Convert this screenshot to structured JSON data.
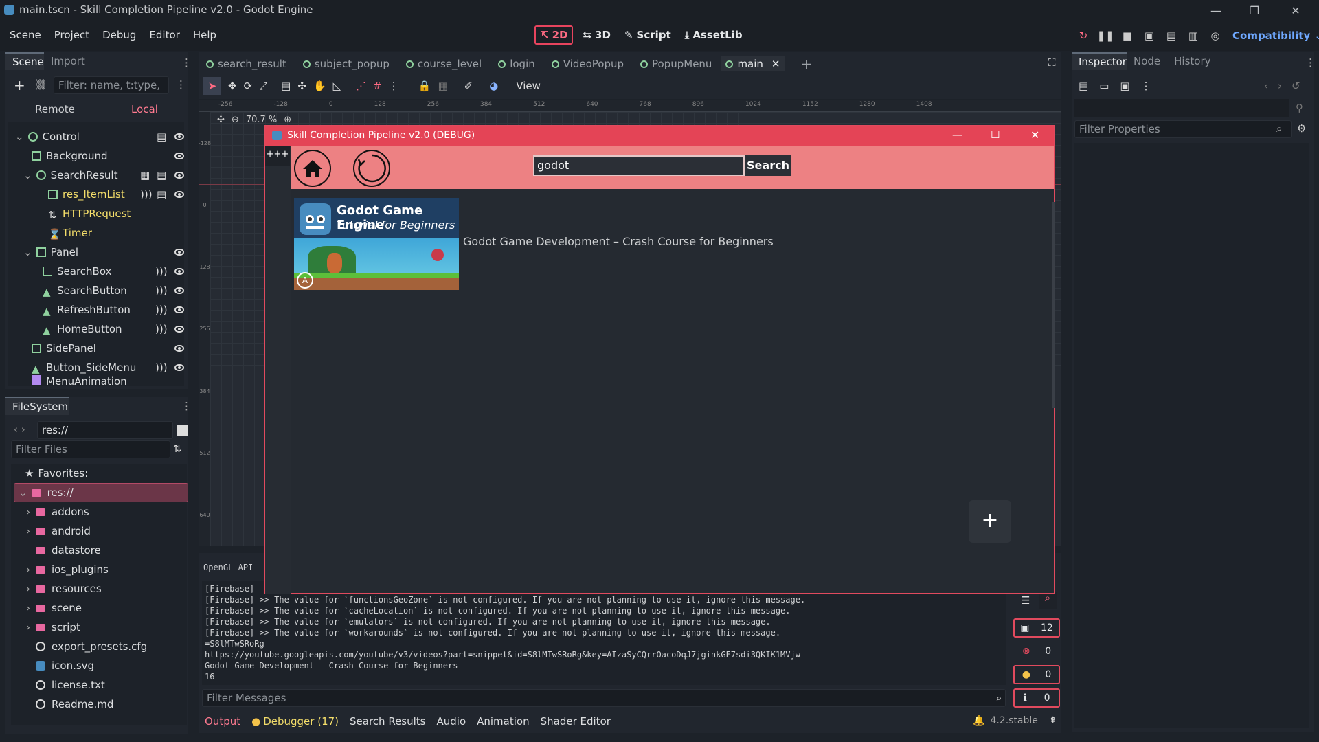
{
  "window": {
    "title": "main.tscn - Skill Completion Pipeline v2.0 - Godot Engine"
  },
  "menu": [
    "Scene",
    "Project",
    "Debug",
    "Editor",
    "Help"
  ],
  "modes": [
    {
      "label": "2D",
      "active": true
    },
    {
      "label": "3D"
    },
    {
      "label": "Script"
    },
    {
      "label": "AssetLib"
    }
  ],
  "renderer": "Compatibility",
  "scene_panel": {
    "tabs": [
      "Scene",
      "Import"
    ],
    "filter_placeholder": "Filter: name, t:type,",
    "remote": "Remote",
    "local": "Local",
    "nodes": [
      "Control",
      "Background",
      "SearchResult",
      "res_ItemList",
      "HTTPRequest",
      "Timer",
      "Panel",
      "SearchBox",
      "SearchButton",
      "RefreshButton",
      "HomeButton",
      "SidePanel",
      "Button_SideMenu",
      "MenuAnimation"
    ]
  },
  "filesystem": {
    "tab": "FileSystem",
    "path": "res://",
    "filter_placeholder": "Filter Files",
    "favorites": "Favorites:",
    "root": "res://",
    "items": [
      "addons",
      "android",
      "datastore",
      "ios_plugins",
      "resources",
      "scene",
      "script",
      "export_presets.cfg",
      "icon.svg",
      "license.txt",
      "Readme.md"
    ]
  },
  "scene_tabs": [
    "search_result",
    "subject_popup",
    "course_level",
    "login",
    "VideoPopup",
    "PopupMenu",
    "main"
  ],
  "toolbar": {
    "view": "View",
    "zoom": "70.7 %"
  },
  "ruler": [
    "-256",
    "-128",
    "0",
    "128",
    "256",
    "384",
    "512",
    "640",
    "768",
    "896",
    "1024",
    "1152",
    "1280",
    "1408"
  ],
  "vruler": [
    "-128",
    "0",
    "128",
    "256",
    "384",
    "512",
    "640"
  ],
  "game": {
    "title": "Skill Completion Pipeline v2.0 (DEBUG)",
    "side_btn": "+++",
    "search_value": "godot",
    "search_btn": "Search",
    "thumb_title1": "Godot Game Engine",
    "thumb_title2": "Tutorial for Beginners",
    "result_title": "Godot Game Development – Crash Course for Beginners",
    "add_btn": "+"
  },
  "output": {
    "api": "OpenGL API",
    "lines": [
      "[Firebase]",
      "[Firebase] >> The value for `functionsGeoZone` is not configured. If you are not planning to use it, ignore this message.",
      "[Firebase] >> The value for `cacheLocation` is not configured. If you are not planning to use it, ignore this message.",
      "[Firebase] >> The value for `emulators` is not configured. If you are not planning to use it, ignore this message.",
      "[Firebase] >> The value for `workarounds` is not configured. If you are not planning to use it, ignore this message.",
      "=S8lMTwSRoRg",
      "https://youtube.googleapis.com/youtube/v3/videos?part=snippet&id=S8lMTwSRoRg&key=AIzaSyCQrrOacoDqJ7jginkGE7sdi3QKIK1MVjw",
      "Godot Game Development – Crash Course for Beginners",
      "16"
    ],
    "filter_placeholder": "Filter Messages",
    "counts": [
      "12",
      "0",
      "0",
      "0"
    ]
  },
  "bottom_tabs": [
    "Output",
    "Debugger (17)",
    "Search Results",
    "Audio",
    "Animation",
    "Shader Editor"
  ],
  "version": "4.2.stable",
  "inspector": {
    "tabs": [
      "Inspector",
      "Node",
      "History"
    ],
    "filter_placeholder": "Filter Properties"
  }
}
